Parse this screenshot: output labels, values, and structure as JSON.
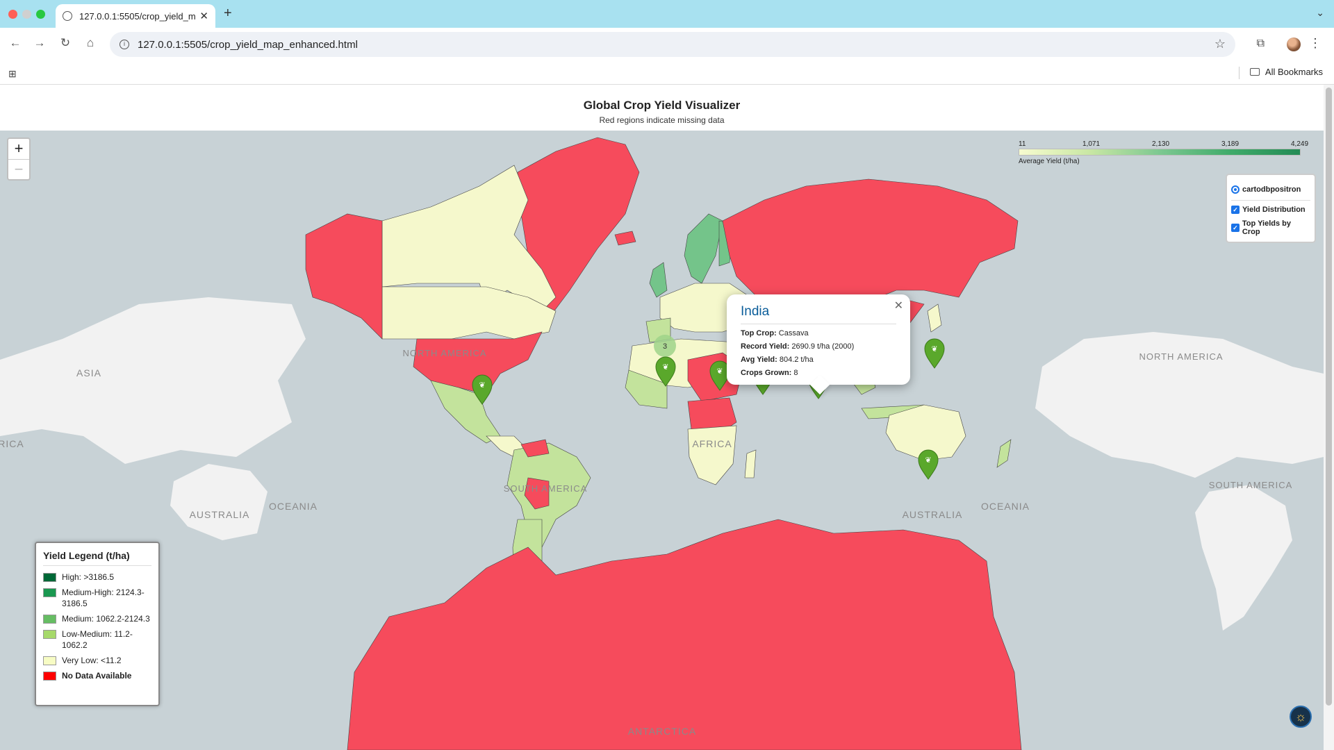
{
  "browser": {
    "tab_title": "127.0.0.1:5505/crop_yield_m",
    "url": "127.0.0.1:5505/crop_yield_map_enhanced.html",
    "bookmarks_label": "All Bookmarks"
  },
  "page": {
    "title": "Global Crop Yield Visualizer",
    "subtitle": "Red regions indicate missing data"
  },
  "zoom": {
    "in": "+",
    "out": "−"
  },
  "colorbar": {
    "ticks": [
      "11",
      "1,071",
      "2,130",
      "3,189",
      "4,249"
    ],
    "caption": "Average Yield (t/ha)"
  },
  "layers": {
    "base": "cartodbpositron",
    "overlays": [
      "Yield Distribution",
      "Top Yields by Crop"
    ]
  },
  "popup": {
    "country": "India",
    "top_crop_label": "Top Crop:",
    "top_crop": "Cassava",
    "record_label": "Record Yield:",
    "record": "2690.9 t/ha (2000)",
    "avg_label": "Avg Yield:",
    "avg": "804.2 t/ha",
    "crops_label": "Crops Grown:",
    "crops": "8"
  },
  "legend": {
    "title": "Yield Legend (t/ha)",
    "items": [
      {
        "label": "High: >3186.5",
        "color": "#006837"
      },
      {
        "label": "Medium-High: 2124.3-3186.5",
        "color": "#1a9850"
      },
      {
        "label": "Medium: 1062.2-2124.3",
        "color": "#66bd63"
      },
      {
        "label": "Low-Medium: 11.2-1062.2",
        "color": "#a6d96a"
      },
      {
        "label": "Very Low: <11.2",
        "color": "#f7fcc4"
      },
      {
        "label": "No Data Available",
        "color": "#ff0000"
      }
    ]
  },
  "map_labels": {
    "north_america": "NORTH AMERICA",
    "north_america_right": "NORTH AMERICA",
    "south_america": "SOUTH AMERICA",
    "south_america_right": "SOUTH AMERICA",
    "asia_left": "ASIA",
    "africa_left": "RICA",
    "africa": "AFRICA",
    "australia_left": "AUSTRALIA",
    "australia": "AUSTRALIA",
    "oceania_left": "OCEANIA",
    "oceania": "OCEANIA",
    "antarctica": "ANTARCTICA",
    "cluster_count": "3"
  },
  "colors": {
    "no_data": "#f64b5c",
    "very_low": "#f5f8cc",
    "low_medium": "#c3e39c",
    "medium": "#74c48a",
    "marker": "#5aa82b",
    "water": "#c8d2d6",
    "land_bg": "#f2f2f2"
  }
}
